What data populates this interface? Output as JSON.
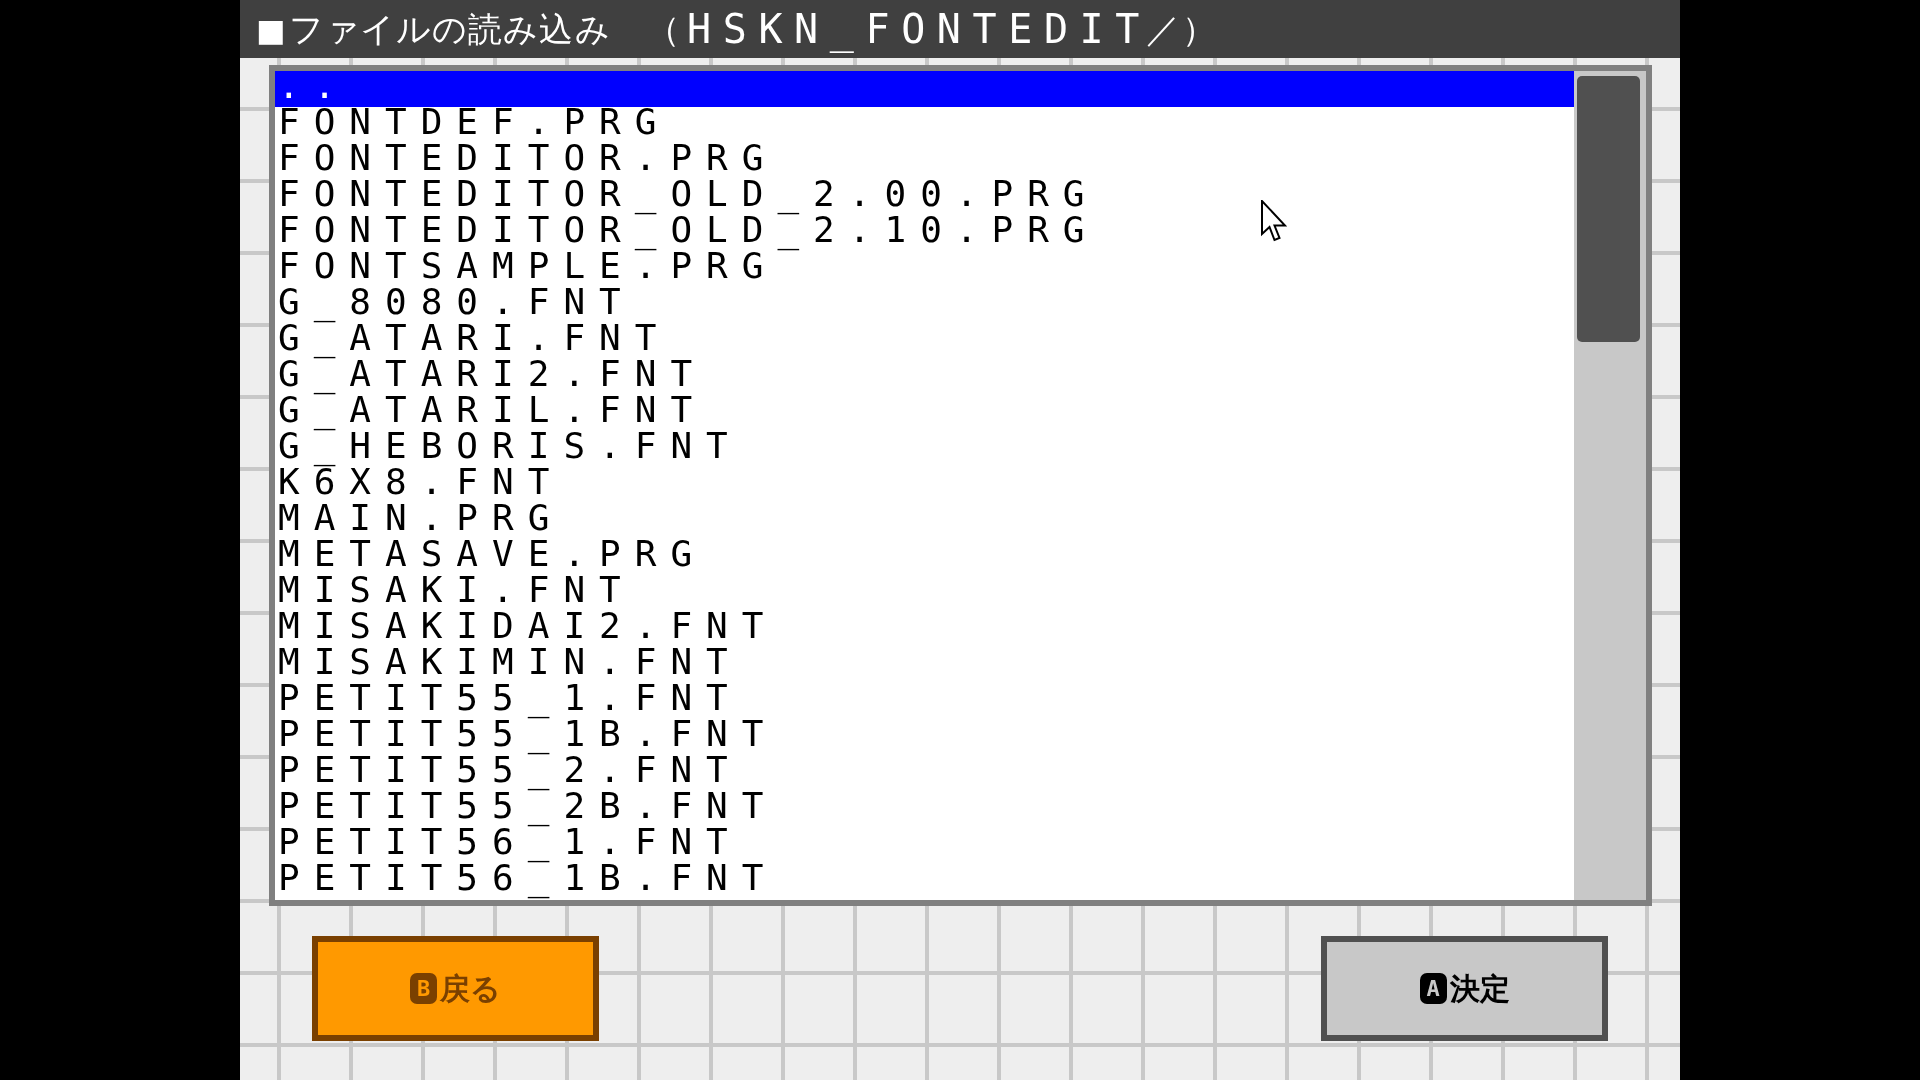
{
  "title": "■ファイルの読み込み （HSKN_FONTEDIT／）",
  "files": [
    {
      "name": "..",
      "selected": true
    },
    {
      "name": "FONTDEF.PRG",
      "selected": false
    },
    {
      "name": "FONTEDITOR.PRG",
      "selected": false
    },
    {
      "name": "FONTEDITOR_OLD_2.00.PRG",
      "selected": false
    },
    {
      "name": "FONTEDITOR_OLD_2.10.PRG",
      "selected": false
    },
    {
      "name": "FONTSAMPLE.PRG",
      "selected": false
    },
    {
      "name": "G_8080.FNT",
      "selected": false
    },
    {
      "name": "G_ATARI.FNT",
      "selected": false
    },
    {
      "name": "G_ATARI2.FNT",
      "selected": false
    },
    {
      "name": "G_ATARIL.FNT",
      "selected": false
    },
    {
      "name": "G_HEBORIS.FNT",
      "selected": false
    },
    {
      "name": "K6X8.FNT",
      "selected": false
    },
    {
      "name": "MAIN.PRG",
      "selected": false
    },
    {
      "name": "METASAVE.PRG",
      "selected": false
    },
    {
      "name": "MISAKI.FNT",
      "selected": false
    },
    {
      "name": "MISAKIDAI2.FNT",
      "selected": false
    },
    {
      "name": "MISAKIMIN.FNT",
      "selected": false
    },
    {
      "name": "PETIT55_1.FNT",
      "selected": false
    },
    {
      "name": "PETIT55_1B.FNT",
      "selected": false
    },
    {
      "name": "PETIT55_2.FNT",
      "selected": false
    },
    {
      "name": "PETIT55_2B.FNT",
      "selected": false
    },
    {
      "name": "PETIT56_1.FNT",
      "selected": false
    },
    {
      "name": "PETIT56_1B.FNT",
      "selected": false
    }
  ],
  "buttons": [
    {
      "kind": "accent",
      "key": "B",
      "label": "戻る"
    },
    {
      "kind": "neutral",
      "key": "A",
      "label": "決定"
    }
  ]
}
